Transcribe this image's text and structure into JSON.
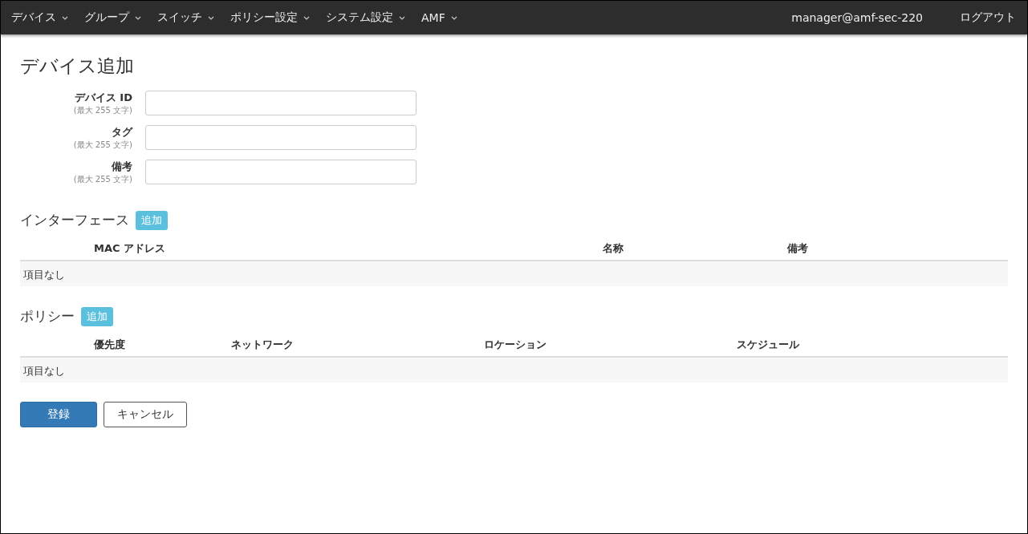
{
  "navbar": {
    "menus": [
      {
        "label": "デバイス"
      },
      {
        "label": "グループ"
      },
      {
        "label": "スイッチ"
      },
      {
        "label": "ポリシー設定"
      },
      {
        "label": "システム設定"
      },
      {
        "label": "AMF"
      }
    ],
    "user": "manager@amf-sec-220",
    "logout": "ログアウト"
  },
  "page_title": "デバイス追加",
  "form": {
    "fields": [
      {
        "label": "デバイス ID",
        "hint": "(最大 255 文字)"
      },
      {
        "label": "タグ",
        "hint": "(最大 255 文字)"
      },
      {
        "label": "備考",
        "hint": "(最大 255 文字)"
      }
    ]
  },
  "sections": [
    {
      "title": "インターフェース",
      "add_button": "追加",
      "table": {
        "columns": [
          "MAC アドレス",
          "名称",
          "備考"
        ],
        "empty_text": "項目なし"
      }
    },
    {
      "title": "ポリシー",
      "add_button": "追加",
      "table": {
        "columns": [
          "優先度",
          "ネットワーク",
          "ロケーション",
          "スケジュール"
        ],
        "empty_text": "項目なし"
      }
    }
  ],
  "buttons": [
    {
      "label": "登録",
      "kind": "primary"
    },
    {
      "label": "キャンセル",
      "kind": "default"
    }
  ]
}
